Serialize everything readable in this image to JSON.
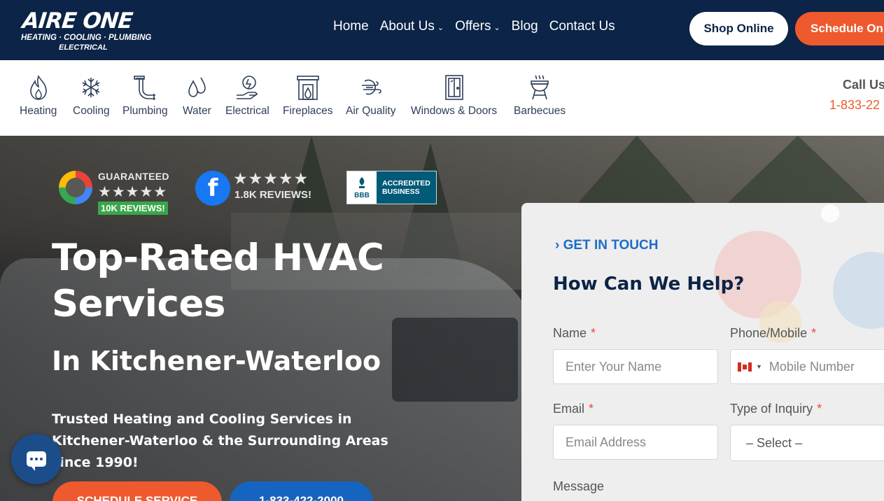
{
  "header": {
    "logo_main": "AIRE ONE",
    "logo_line1": "HEATING · COOLING · PLUMBING",
    "logo_line2": "ELECTRICAL",
    "nav": [
      {
        "label": "Home",
        "dropdown": false
      },
      {
        "label": "About Us",
        "dropdown": true
      },
      {
        "label": "Offers",
        "dropdown": true
      },
      {
        "label": "Blog",
        "dropdown": false
      },
      {
        "label": "Contact Us",
        "dropdown": false
      }
    ],
    "shop_label": "Shop Online",
    "schedule_label": "Schedule Online"
  },
  "services": {
    "items": [
      {
        "label": "Heating",
        "icon": "flame-icon"
      },
      {
        "label": "Cooling",
        "icon": "snowflake-icon"
      },
      {
        "label": "Plumbing",
        "icon": "pipe-icon"
      },
      {
        "label": "Water",
        "icon": "water-drops-icon"
      },
      {
        "label": "Electrical",
        "icon": "lightbulb-hand-icon"
      },
      {
        "label": "Fireplaces",
        "icon": "fireplace-icon"
      },
      {
        "label": "Air Quality",
        "icon": "air-flow-icon"
      },
      {
        "label": "Windows & Doors",
        "icon": "door-window-icon"
      },
      {
        "label": "Barbecues",
        "icon": "barbecue-icon"
      }
    ],
    "call_label": "Call Us",
    "call_number": "1-833-22"
  },
  "hero": {
    "google_badge": {
      "guaranteed": "GUARANTEED",
      "stars": "★★★★★",
      "reviews": "10K REVIEWS!"
    },
    "facebook_badge": {
      "stars": "★★★★★",
      "reviews": "1.8K REVIEWS!"
    },
    "bbb_badge": {
      "line1": "ACCREDITED",
      "line2": "BUSINESS",
      "mark": "BBB"
    },
    "title": "Top-Rated HVAC Services",
    "subtitle": "In Kitchener-Waterloo",
    "description": "Trusted Heating and Cooling Services in Kitchener-Waterloo & the Surrounding Areas since 1990!",
    "button_schedule": "SCHEDULE SERVICE",
    "button_phone": "1-833-422-2000"
  },
  "form": {
    "eyebrow": "› GET IN TOUCH",
    "title": "How Can We Help?",
    "name_label": "Name",
    "name_placeholder": "Enter Your Name",
    "phone_label": "Phone/Mobile",
    "phone_placeholder": "Mobile Number",
    "email_label": "Email",
    "email_placeholder": "Email Address",
    "inquiry_label": "Type of Inquiry",
    "inquiry_selected": "– Select –",
    "message_label": "Message",
    "required_mark": "*"
  },
  "colors": {
    "navy": "#0b2447",
    "orange": "#ee5a2d",
    "blue_link": "#1e6cc8"
  }
}
